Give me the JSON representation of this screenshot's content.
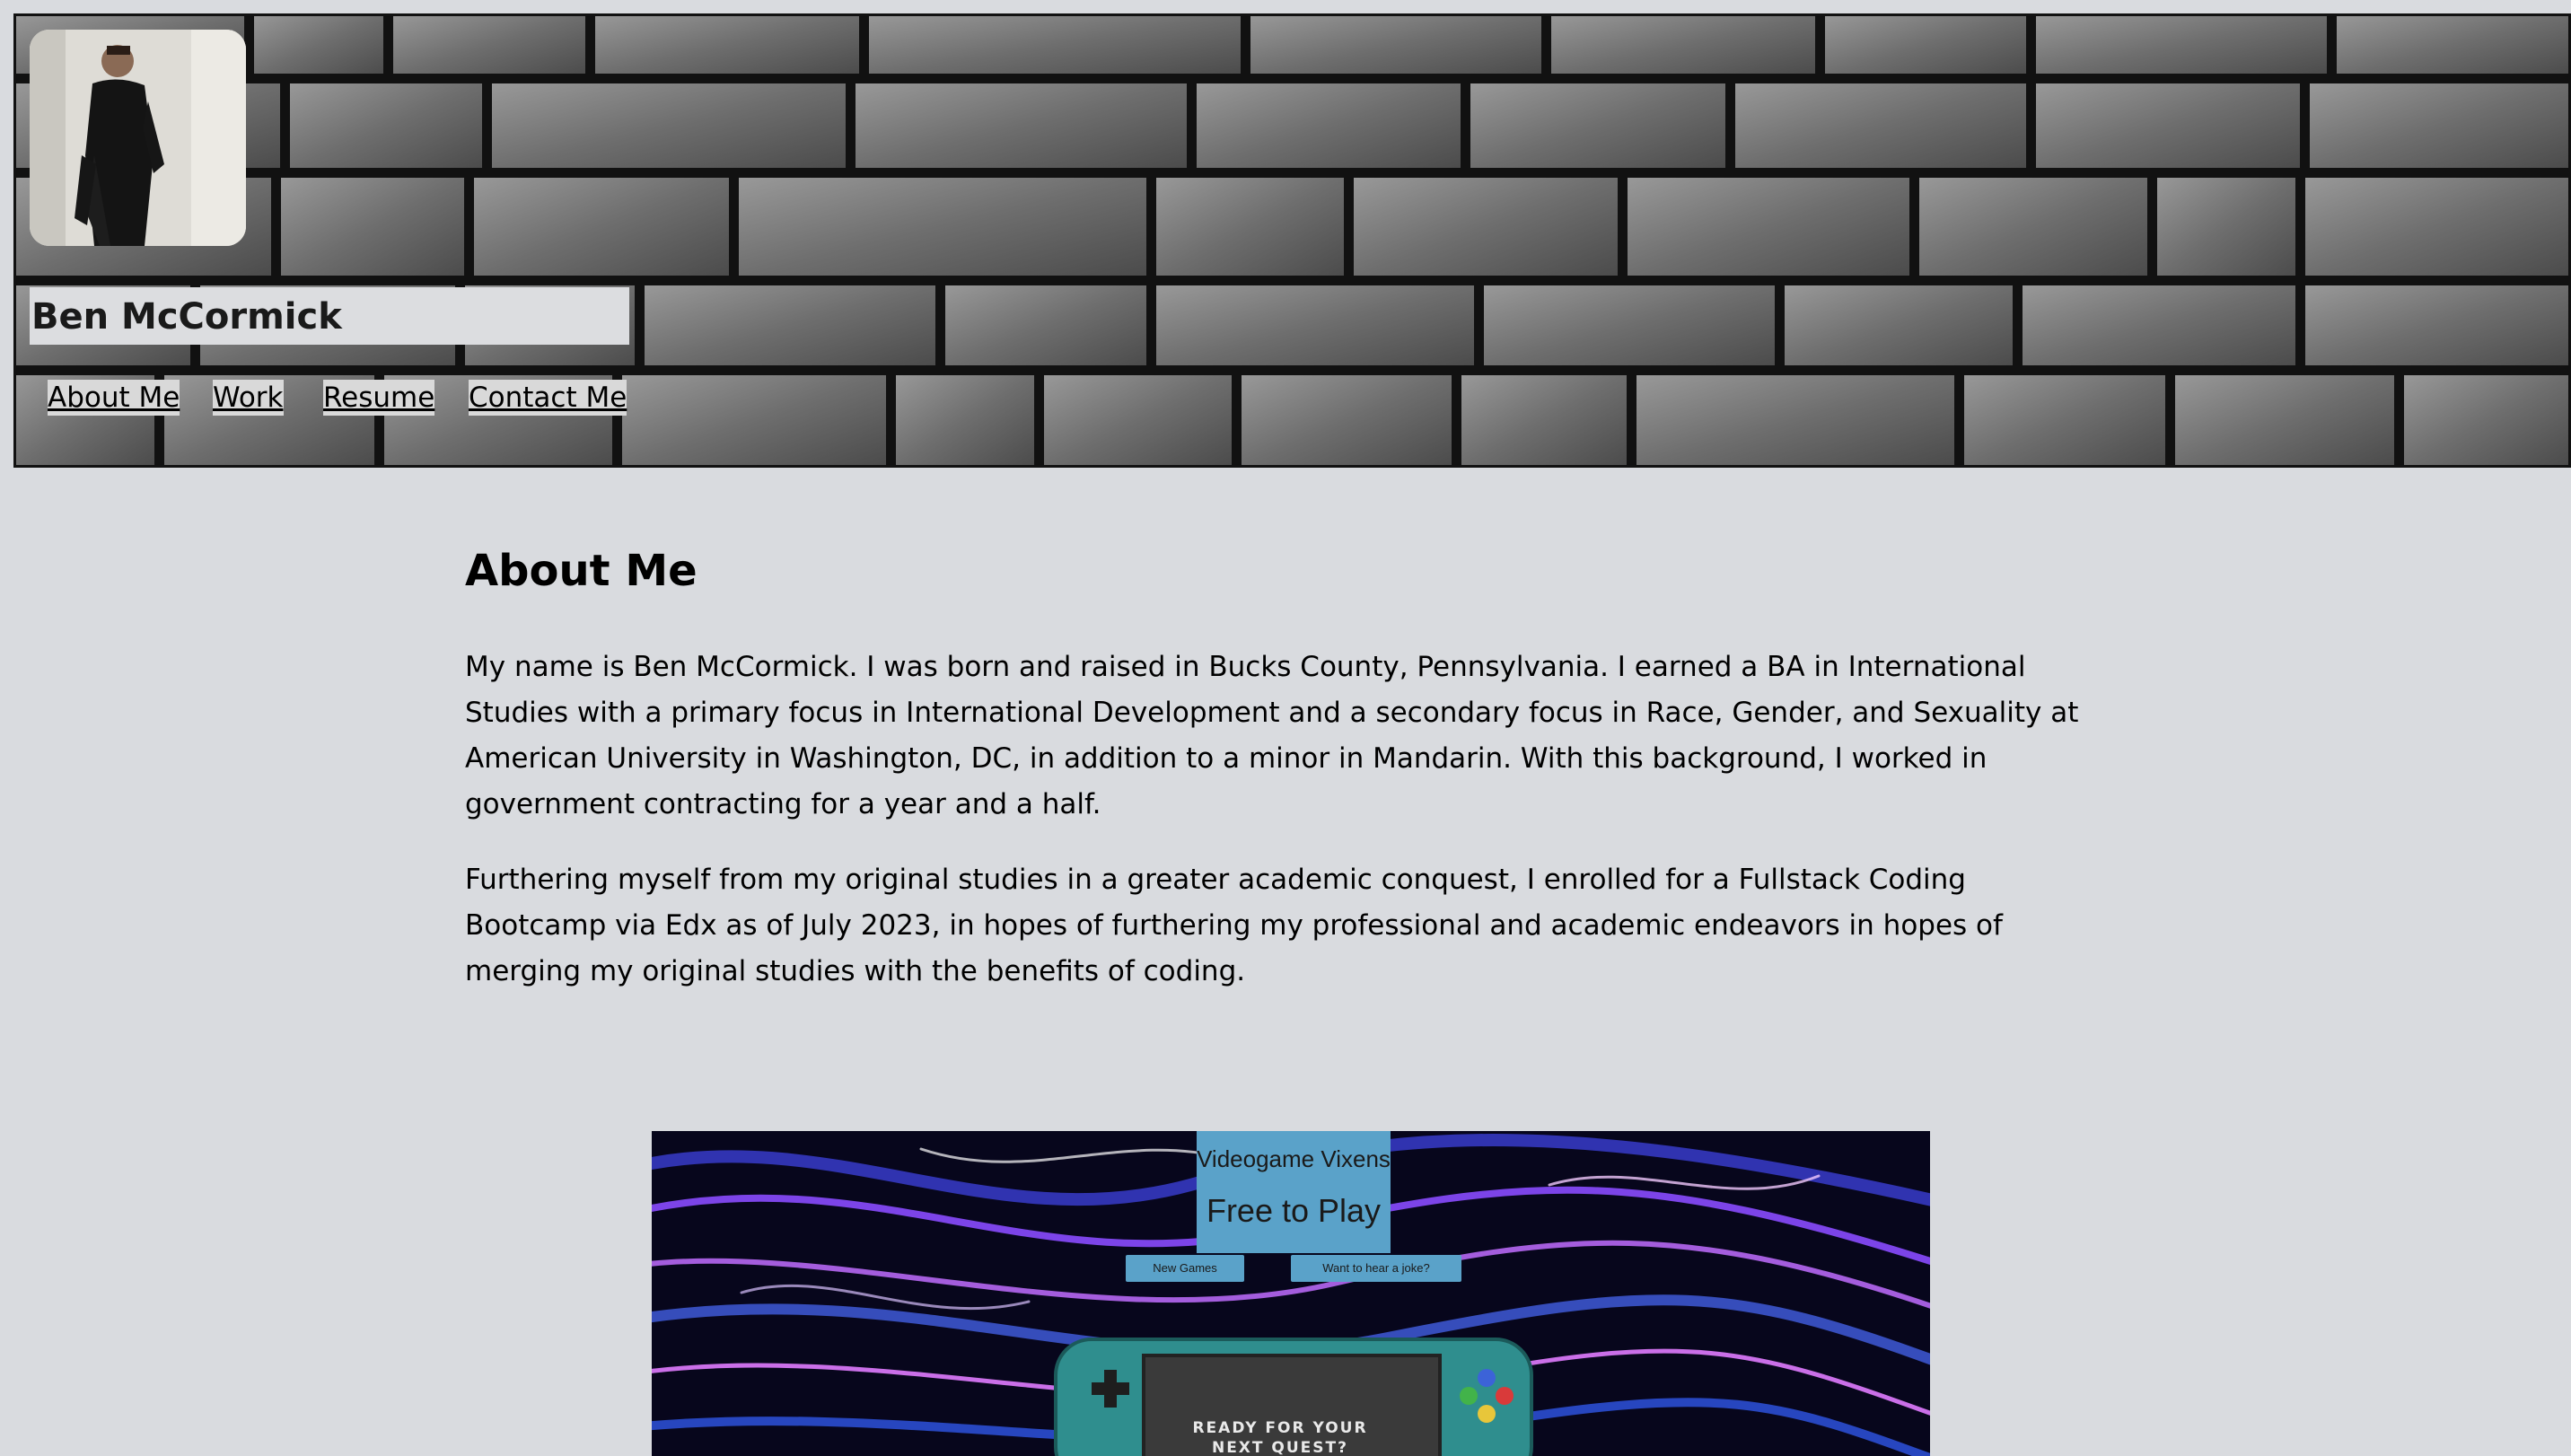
{
  "header": {
    "name": "Ben McCormick",
    "nav": [
      {
        "label": "About Me"
      },
      {
        "label": "Work"
      },
      {
        "label": "Resume"
      },
      {
        "label": "Contact Me"
      }
    ]
  },
  "about": {
    "heading": "About Me",
    "paragraphs": [
      "My name is Ben McCormick. I was born and raised in Bucks County, Pennsylvania. I earned a BA in International Studies with a primary focus in International Development and a secondary focus in Race, Gender, and Sexuality at American University in Washington, DC, in addition to a minor in Mandarin. With this background, I worked in government contracting for a year and a half.",
      "Furthering myself from my original studies in a greater academic conquest, I enrolled for a Fullstack Coding Bootcamp via Edx as of July 2023, in hopes of furthering my professional and academic endeavors in hopes of merging my original studies with the benefits of coding."
    ]
  },
  "project": {
    "title": "Videogame Vixens",
    "subtitle": "Free to Play",
    "buttons": [
      "New Games",
      "Want to hear a joke?"
    ],
    "console_text": "Ready for your next quest?"
  },
  "colors": {
    "page_bg": "#d9dbdf",
    "name_box_bg": "#dcdde0",
    "project_accent": "#5aa2c9"
  }
}
